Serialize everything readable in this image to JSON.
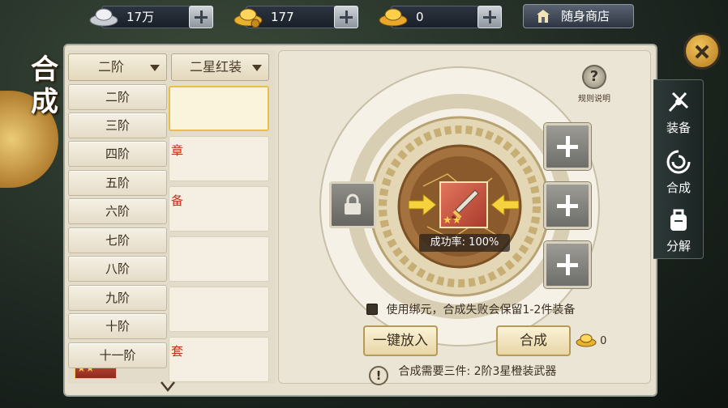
{
  "currency": {
    "silver": {
      "amount": "17万",
      "icon": "silver-ingot-icon"
    },
    "gold": {
      "amount": "177",
      "icon": "gold-ingot-icon"
    },
    "bound_gold": {
      "amount": "0",
      "icon": "bound-gold-ingot-icon"
    }
  },
  "shop": {
    "label": "随身商店",
    "icon": "shop-icon"
  },
  "page_title": [
    "合",
    "成"
  ],
  "filters": {
    "tier": {
      "selected": "二阶"
    },
    "quality": {
      "selected": "二星红装"
    }
  },
  "tier_options": [
    "二阶",
    "三阶",
    "四阶",
    "五阶",
    "六阶",
    "七阶",
    "八阶",
    "九阶",
    "十阶",
    "十一阶"
  ],
  "list_partial_texts": [
    "章",
    "备",
    "",
    "",
    "套"
  ],
  "rules": {
    "label": "规则说明",
    "icon": "question-icon"
  },
  "synth": {
    "success_rate": "成功率: 100%",
    "bind_option": "使用绑元，合成失败会保留1-2件装备",
    "auto_fill_label": "一键放入",
    "synth_label": "合成",
    "cost": "0",
    "requirement": "合成需要三件: 2阶3星橙装武器"
  },
  "tabs": [
    {
      "label": "装备",
      "icon": "equipment-icon"
    },
    {
      "label": "合成",
      "icon": "synthesis-icon"
    },
    {
      "label": "分解",
      "icon": "decompose-icon"
    }
  ],
  "colors": {
    "accent_gold": "#e8c048",
    "text_red": "#c0301e",
    "panel_bg": "#e7e0cf"
  }
}
